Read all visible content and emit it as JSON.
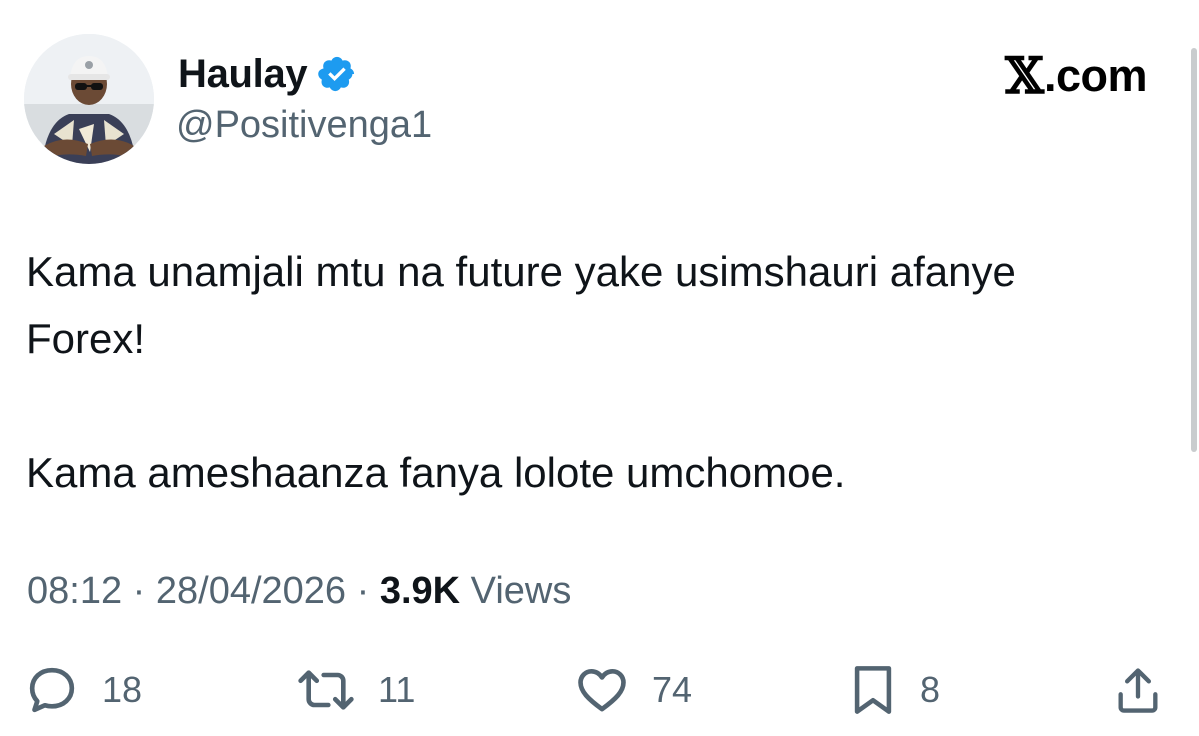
{
  "author": {
    "display_name": "Haulay",
    "handle": "@Positivenga1",
    "verified": true,
    "avatar": "profile-photo"
  },
  "brand": {
    "mark": "𝕏",
    "text": ".com"
  },
  "tweet": {
    "lines": [
      "Kama unamjali mtu na future yake usimshauri afanye Forex!",
      "Kama ameshaanza fanya lolote umchomoe."
    ]
  },
  "meta": {
    "time": "08:12",
    "sep1": " · ",
    "date": "28/04/2026",
    "sep2": " · ",
    "views_count": "3.9K",
    "views_label": " Views"
  },
  "actions": {
    "replies": "18",
    "retweets": "11",
    "likes": "74",
    "bookmarks": "8"
  },
  "icons": {
    "reply": "reply-icon",
    "retweet": "retweet-icon",
    "like": "heart-icon",
    "bookmark": "bookmark-icon",
    "share": "share-icon",
    "verified": "verified-badge-icon"
  },
  "colors": {
    "text_primary": "#0f1419",
    "text_secondary": "#536471",
    "verified_blue": "#1d9bf0"
  }
}
